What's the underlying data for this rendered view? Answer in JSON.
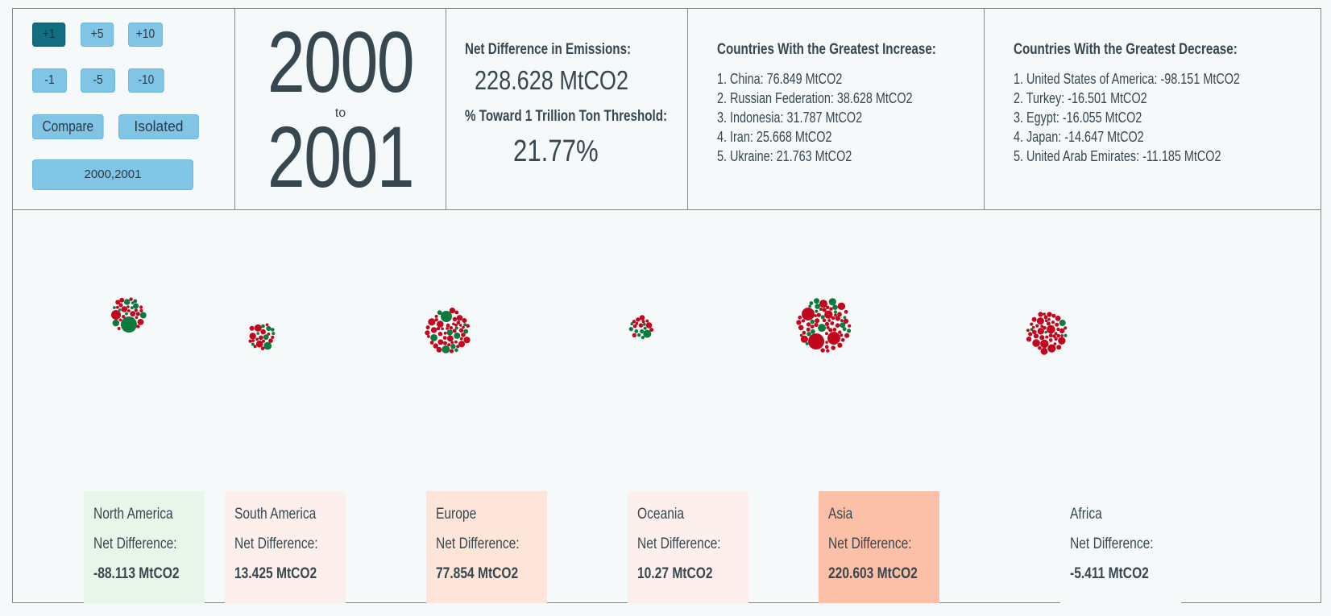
{
  "controls": {
    "increment_buttons": [
      "+1",
      "+5",
      "+10"
    ],
    "decrement_buttons": [
      "-1",
      "-5",
      "-10"
    ],
    "compare_label": "Compare",
    "isolated_label": "Isolated",
    "years_field": "2000,2001",
    "active_button": "+1"
  },
  "years": {
    "from": "2000",
    "to_label": "to",
    "to": "2001"
  },
  "summary": {
    "net_heading": "Net Difference in Emissions:",
    "net_value": "228.628 MtCO2",
    "threshold_heading": "% Toward 1 Trillion Ton Threshold:",
    "threshold_value": "21.77%"
  },
  "increase": {
    "heading": "Countries With the Greatest Increase:",
    "items": [
      "1. China: 76.849 MtCO2",
      "2. Russian Federation: 38.628 MtCO2",
      "3. Indonesia: 31.787 MtCO2",
      "4. Iran: 25.668 MtCO2",
      "5. Ukraine: 21.763 MtCO2"
    ]
  },
  "decrease": {
    "heading": "Countries With the Greatest Decrease:",
    "items": [
      "1. United States of America: -98.151 MtCO2",
      "2. Turkey: -16.501 MtCO2",
      "3. Egypt: -16.055 MtCO2",
      "4. Japan: -14.647 MtCO2",
      "5. United Arab Emirates: -11.185 MtCO2"
    ]
  },
  "colors": {
    "increase": "#c0071d",
    "decrease": "#0b7a3e",
    "button": "#80c4e6",
    "button_active": "#136d80"
  },
  "regions": [
    {
      "name": "North America",
      "label": "Net Difference:",
      "value": "-88.113 MtCO2",
      "bg": "#e8f5e9"
    },
    {
      "name": "South America",
      "label": "Net Difference:",
      "value": "13.425 MtCO2",
      "bg": "#fdf0ec"
    },
    {
      "name": "Europe",
      "label": "Net Difference:",
      "value": "77.854 MtCO2",
      "bg": "#fde5da"
    },
    {
      "name": "Oceania",
      "label": "Net Difference:",
      "value": "10.27 MtCO2",
      "bg": "#fdf0ec"
    },
    {
      "name": "Asia",
      "label": "Net Difference:",
      "value": "220.603 MtCO2",
      "bg": "#fcc0a8"
    },
    {
      "name": "Africa",
      "label": "Net Difference:",
      "value": "-5.411 MtCO2",
      "bg": "#f5f9fa"
    }
  ]
}
